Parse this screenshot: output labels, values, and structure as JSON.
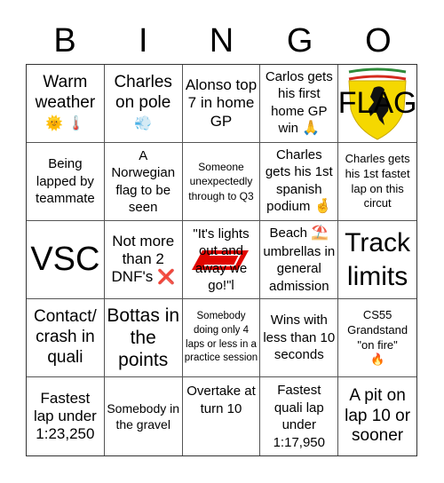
{
  "header": {
    "letters": [
      "B",
      "I",
      "N",
      "G",
      "O"
    ]
  },
  "cells": [
    {
      "text": "Warm weather",
      "emoji": "🌞 🌡️"
    },
    {
      "text": "Charles on pole",
      "emoji": "💨"
    },
    {
      "text": "Alonso top 7 in home GP",
      "emoji": ""
    },
    {
      "text": "Carlos gets his first home GP win",
      "emoji": "🙏"
    },
    {
      "text": "FLAG",
      "emoji": "",
      "image": "ferrari-shield"
    },
    {
      "text": "Being lapped by teammate",
      "emoji": ""
    },
    {
      "text": "A Norwegian flag to be seen",
      "emoji": ""
    },
    {
      "text": "Someone unexpectedly through to Q3",
      "emoji": ""
    },
    {
      "text": "Charles gets his 1st spanish podium",
      "emoji": "🤞"
    },
    {
      "text": "Charles gets his 1st fastet lap on this circut",
      "emoji": ""
    },
    {
      "text": "VSC",
      "emoji": ""
    },
    {
      "text": "Not more than 2 DNF's",
      "emoji": "❌"
    },
    {
      "text": "\"It's lights out and away we go!\"l",
      "emoji": "",
      "image": "f1-logo"
    },
    {
      "text": "Beach",
      "emoji": "⛱️",
      "text2": "umbrellas in general admission"
    },
    {
      "text": "Track limits",
      "emoji": ""
    },
    {
      "text": "Contact/ crash in quali",
      "emoji": ""
    },
    {
      "text": "Bottas in the points",
      "emoji": ""
    },
    {
      "text": "Somebody doing only 4 laps or less in a practice session",
      "emoji": ""
    },
    {
      "text": "Wins with less than 10 seconds",
      "emoji": ""
    },
    {
      "text": "CS55 Grandstand \"on fire\"",
      "emoji": "🔥"
    },
    {
      "text": "Fastest lap under 1:23,250",
      "emoji": ""
    },
    {
      "text": "Somebody in the gravel",
      "emoji": ""
    },
    {
      "text": "Overtake at turn 10",
      "emoji": ""
    },
    {
      "text": "Fastest quali lap under 1:17,950",
      "emoji": ""
    },
    {
      "text": "A pit on lap 10 or sooner",
      "emoji": ""
    }
  ]
}
